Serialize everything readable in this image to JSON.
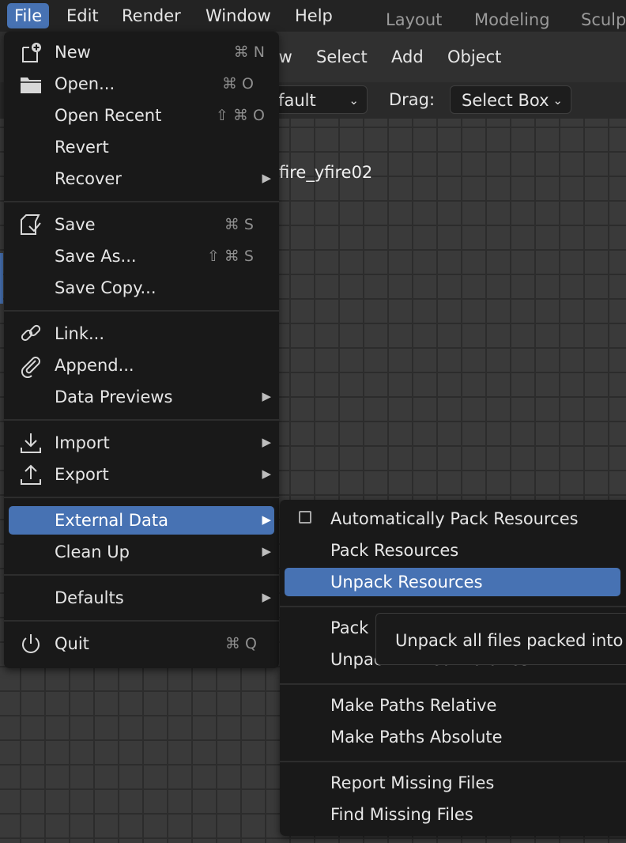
{
  "topbar": {
    "menus": [
      "File",
      "Edit",
      "Render",
      "Window",
      "Help"
    ],
    "workspaces": [
      "Layout",
      "Modeling",
      "Sculp"
    ]
  },
  "editor_header": {
    "menus": [
      "View",
      "Select",
      "Add",
      "Object"
    ],
    "orientation_value": "Default",
    "drag_label": "Drag:",
    "drag_value": "Select Box"
  },
  "viewport": {
    "object_name": "fire_yfire02"
  },
  "file_menu": {
    "items": [
      {
        "label": "New",
        "shortcut": "⌘ N",
        "icon": "new-file-icon"
      },
      {
        "label": "Open...",
        "shortcut": "⌘ O",
        "icon": "folder-icon"
      },
      {
        "label": "Open Recent",
        "shortcut": "⇧ ⌘ O"
      },
      {
        "label": "Revert"
      },
      {
        "label": "Recover"
      },
      {
        "label": "Save",
        "shortcut": "⌘ S",
        "icon": "save-icon"
      },
      {
        "label": "Save As...",
        "shortcut": "⇧ ⌘ S"
      },
      {
        "label": "Save Copy..."
      },
      {
        "label": "Link...",
        "icon": "link-icon"
      },
      {
        "label": "Append...",
        "icon": "paperclip-icon"
      },
      {
        "label": "Data Previews"
      },
      {
        "label": "Import",
        "icon": "import-icon"
      },
      {
        "label": "Export",
        "icon": "export-icon"
      },
      {
        "label": "External Data"
      },
      {
        "label": "Clean Up"
      },
      {
        "label": "Defaults"
      },
      {
        "label": "Quit",
        "shortcut": "⌘ Q",
        "icon": "power-icon"
      }
    ]
  },
  "external_data_menu": {
    "items": [
      {
        "label": "Automatically Pack Resources",
        "checked": false
      },
      {
        "label": "Pack Resources"
      },
      {
        "label": "Unpack Resources"
      },
      {
        "label": "Pack Linked Libraries"
      },
      {
        "label": "Unpack Linked Libraries"
      },
      {
        "label": "Make Paths Relative"
      },
      {
        "label": "Make Paths Absolute"
      },
      {
        "label": "Report Missing Files"
      },
      {
        "label": "Find Missing Files"
      }
    ]
  },
  "tooltip": {
    "text": "Unpack all files packed into"
  },
  "colors": {
    "accent": "#4772b3",
    "menu_bg": "#191919",
    "topbar_bg": "#232323"
  }
}
